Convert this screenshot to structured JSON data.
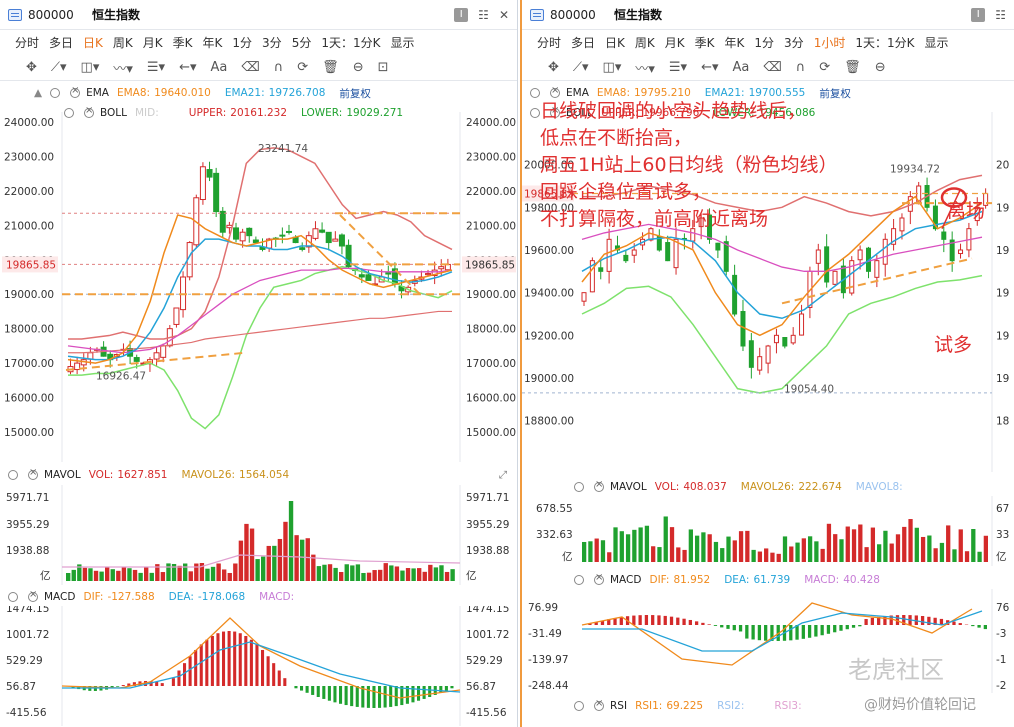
{
  "colors": {
    "up": "#d42a2a",
    "down": "#1fa12f",
    "ema8": "#f08a1c",
    "ema21": "#24a3d8",
    "ema60": "#d94fbf",
    "boll": "#e07070",
    "lower": "#7ee26c",
    "dashOrange": "#f0a040",
    "accent": "#e8721c",
    "red": "#e03030"
  },
  "left": {
    "title": {
      "code": "800000",
      "name": "恒生指数",
      "icons": [
        "minimize-icon",
        "settings-icon",
        "close-icon"
      ]
    },
    "periods": [
      "分时",
      "多日",
      "日K",
      "周K",
      "月K",
      "季K",
      "年K",
      "1分",
      "3分",
      "5分",
      "1天：1分K",
      "显示"
    ],
    "active_period": "日K",
    "ema": {
      "name": "EMA",
      "v1_label": "EMA8:",
      "v1": "19640.010",
      "v2_label": "EMA21:",
      "v2": "19726.708",
      "fq": "前复权"
    },
    "boll": {
      "name": "BOLL",
      "mid_label": "MID:",
      "upper_label": "UPPER:",
      "upper": "20161.232",
      "lower_label": "LOWER:",
      "lower": "19029.271"
    },
    "y_axis": [
      "24000.00",
      "23000.00",
      "22000.00",
      "21000.00",
      "20000.00",
      "19000.00",
      "18000.00",
      "17000.00",
      "16000.00",
      "15000.00"
    ],
    "price_tag": "19865.85",
    "ann_high": "23241.74",
    "ann_low": "16926.47",
    "mavol": {
      "name": "MAVOL",
      "vol_label": "VOL:",
      "vol": "1627.851",
      "ma_label": "MAVOL26:",
      "ma": "1564.054",
      "y": [
        "5971.71",
        "3955.29",
        "1938.88",
        "亿"
      ]
    },
    "macd": {
      "name": "MACD",
      "dif_label": "DIF:",
      "dif": "-127.588",
      "dea_label": "DEA:",
      "dea": "-178.068",
      "macd_label": "MACD:",
      "y": [
        "1474.15",
        "1001.72",
        "529.29",
        "56.87",
        "-415.56"
      ]
    }
  },
  "right": {
    "title": {
      "code": "800000",
      "name": "恒生指数"
    },
    "periods": [
      "分时",
      "多日",
      "日K",
      "周K",
      "月K",
      "季K",
      "年K",
      "1分",
      "3分",
      "1小时",
      "1天：1分K",
      "显示"
    ],
    "active_period": "1小时",
    "ema": {
      "name": "EMA",
      "v1_label": "EMA8:",
      "v1": "19795.210",
      "v2_label": "EMA21:",
      "v2": "19700.555",
      "fq": "前复权"
    },
    "boll": {
      "name": "BOLL",
      "upper_label": "UPPER:",
      "upper": "19966.796",
      "lower_label": "LOWER:",
      "lower": "19456.086"
    },
    "y_axis": [
      "20000.00",
      "19800.00",
      "19600.00",
      "19400.00",
      "19200.00",
      "19000.00",
      "18800.00"
    ],
    "price_tag": "19865.85",
    "ann_high": "19934.72",
    "ann_low": "19054.40",
    "mavol": {
      "name": "MAVOL",
      "vol_label": "VOL:",
      "vol": "408.037",
      "ma_label": "MAVOL26:",
      "ma": "222.674",
      "ma2_label": "MAVOL8:",
      "y": [
        "678.55",
        "332.63",
        "亿"
      ]
    },
    "macd": {
      "name": "MACD",
      "dif_label": "DIF:",
      "dif": "81.952",
      "dea_label": "DEA:",
      "dea": "61.739",
      "macd_label": "MACD:",
      "macd": "40.428",
      "y": [
        "76.99",
        "-31.49",
        "-139.97",
        "-248.44"
      ]
    },
    "rsi": {
      "name": "RSI",
      "rsi1_label": "RSI1:",
      "rsi1": "69.225",
      "rsi2_label": "RSI2:",
      "rsi3_label": "RSI3:"
    },
    "annotation_lines": [
      "日线破回调的小空头趋势线后，",
      "低点在不断抬高，",
      "周五1H站上60日均线（粉色均线）",
      "回踩企稳位置试多，",
      "不打算隔夜，前高附近离场"
    ],
    "label_exit": "离场",
    "label_try": "试多",
    "watermark1": "老虎社区",
    "watermark2": "@财妈价值轮回记"
  }
}
